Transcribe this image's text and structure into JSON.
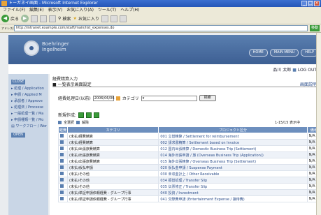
{
  "window": {
    "title": "トーガネイ画面 - Microsoft Internet Explorer"
  },
  "menu": [
    "ファイル(F)",
    "編集(E)",
    "表示(V)",
    "お気に入り(A)",
    "ツール(T)",
    "ヘルプ(H)"
  ],
  "toolbar": {
    "back": "戻る",
    "search": "検索",
    "favorites": "お気に入り"
  },
  "address": {
    "label": "アドレス(D)",
    "url": "http://intranet.example.com/staff/main/list_expenses.do",
    "go": "移動"
  },
  "banner": {
    "brand_line1": "Boehringer",
    "brand_line2": "Ingelheim",
    "pills": [
      "HOME",
      "MAIN MENU",
      "HELP"
    ]
  },
  "user": {
    "name": "品川 太郎",
    "status": "LOG OUT"
  },
  "sidebar": {
    "close": "CLOSE",
    "open": "OPEN",
    "items": [
      "▸ 処理 / Application",
      "▸ 申請 / Applied M",
      "▸ 承認者 / Approve",
      "▸ 処理済 / Processe",
      "▸ 一般処理一覧 / Ma",
      "▸ 申請種類一覧 / Mo",
      "▤ ワークフロー / Wor"
    ]
  },
  "main": {
    "breadcrumb": "経費精算入力",
    "title": "■ 一覧表示画面設定",
    "help": "画面説明",
    "search_label": "経費処理日(以前)",
    "search_date": "2006/06/06",
    "category_label": "カテゴリ",
    "search_button": "検索",
    "new_label": "新規作成:",
    "select_all": "全選択",
    "select_none": "解除",
    "paging": "1-15/15 表示中",
    "columns": [
      "経費",
      "カテゴリ",
      "プロジェクト区分",
      "備考"
    ],
    "rows": [
      [
        "(未払)経費精算",
        "001 立替精算 / Settlement for reimbursement",
        "N/A"
      ],
      [
        "(未払)経費精算",
        "002 請求書精算 / Settlement based on Invoice",
        "N/A"
      ],
      [
        "(未払)出張旅費精算",
        "012 国内出張精算 / Domestic Business Trip (Settlement)",
        "N/A"
      ],
      [
        "(未払)出張旅費精算",
        "014 海外出張申請 / 旅 (Overseas Business Trip (Application))",
        "N/A"
      ],
      [
        "(未払)出張旅費精算",
        "015 海外出張精算 / Overseas Business Trip (Settlement)",
        "N/A"
      ],
      [
        "(未払)仮払申請",
        "020 仮払金申請 / Suspense Payment",
        "N/A"
      ],
      [
        "(未払)その他",
        "030 未収金計上 / Other Receivable",
        "N/A"
      ],
      [
        "(未払)その他",
        "034 振替処理 / Transfer Slip",
        "N/A"
      ],
      [
        "(未払)その他",
        "035 伝票修正 / Transfer Slip",
        "N/A"
      ],
      [
        "(未払)単証申請依頼経費 - グループ行事",
        "040 投資 / Investment",
        "N/A"
      ],
      [
        "(未払)単証申請依頼経費 - グループ行事",
        "041 交際費申請 (Entertainment Expense / 接待費)",
        "N/A"
      ]
    ]
  }
}
